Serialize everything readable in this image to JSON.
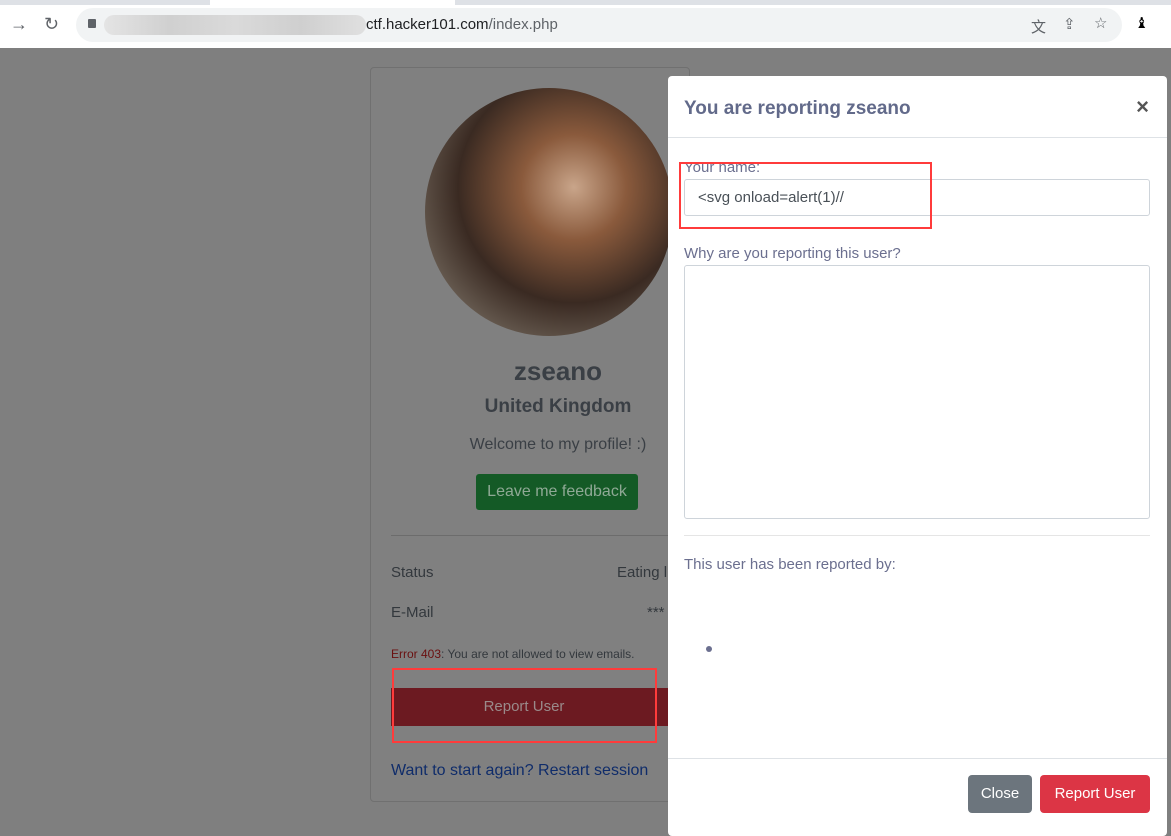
{
  "browser": {
    "url_host": "ctf.hacker101.com",
    "url_path": "/index.php",
    "icons": [
      "back-arrow-icon",
      "reload-icon",
      "lock-icon",
      "translate-icon",
      "share-icon",
      "star-icon",
      "extension-icon"
    ]
  },
  "profile": {
    "username": "zseano",
    "country": "United Kingdom",
    "bio": "Welcome to my profile! :)",
    "feedback_button": "Leave me feedback",
    "status_label": "Status",
    "status_value": "Eating l",
    "email_label": "E-Mail",
    "email_value": "***",
    "error_code": "Error 403",
    "error_message": ": You are not allowed to view emails.",
    "report_button": "Report User",
    "restart_link": "Want to start again? Restart session"
  },
  "modal": {
    "title": "You are reporting zseano",
    "close_symbol": "×",
    "name_label": "Your name:",
    "name_value": "<svg onload=alert(1)//",
    "reason_label": "Why are you reporting this user?",
    "reason_value": "",
    "reported_by_label": "This user has been reported by:",
    "close_button": "Close",
    "report_button": "Report User"
  },
  "colors": {
    "highlight_box": "#ff3b3b",
    "danger": "#dc3545",
    "secondary": "#6c757d",
    "success": "#28a745"
  }
}
